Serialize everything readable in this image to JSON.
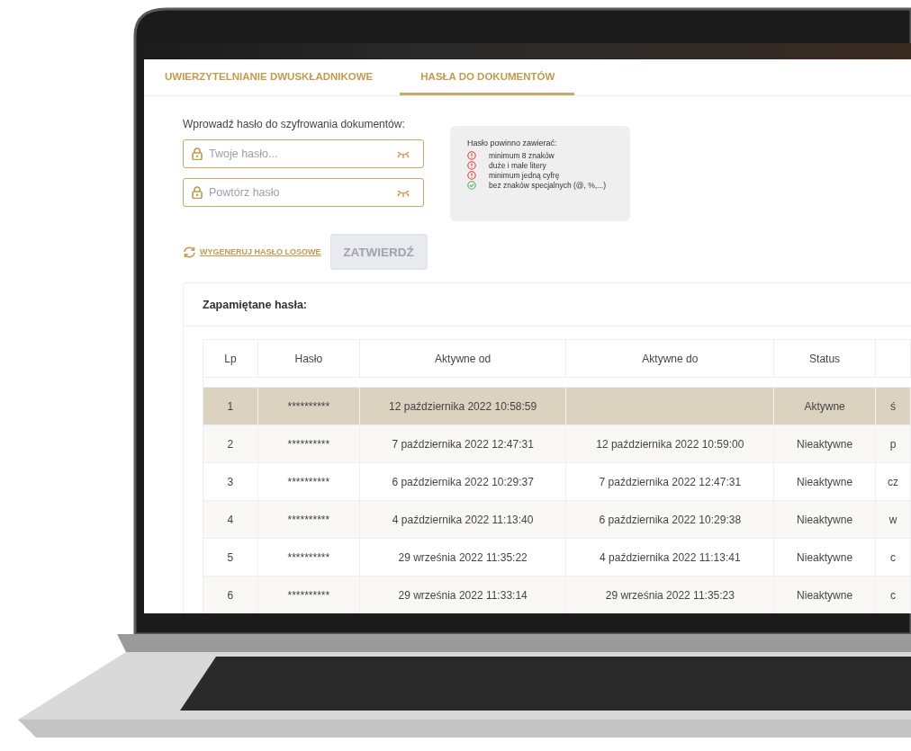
{
  "tabs": [
    {
      "label": "UWIERZYTELNIANIE DWUSKŁADNIKOWE",
      "selected": false
    },
    {
      "label": "HASŁA DO DOKUMENTÓW",
      "selected": true
    }
  ],
  "form": {
    "label": "Wprowadź hasło do szyfrowania dokumentów:",
    "fields": [
      {
        "placeholder": "Twoje hasło..."
      },
      {
        "placeholder": "Powtórz hasło"
      }
    ],
    "hint": {
      "title": "Hasło powinno zawierać:",
      "rules": [
        {
          "text": "minimum 8 znaków",
          "met": false
        },
        {
          "text": "duże i małe litery",
          "met": false
        },
        {
          "text": "minimum jedną cyfrę",
          "met": false
        },
        {
          "text": "bez znaków specjalnych (@, %,...)",
          "met": true
        }
      ]
    },
    "generate_link": "WYGENERUJ HASŁO LOSOWE",
    "submit_button": {
      "label": "ZATWIERDŹ",
      "disabled": true
    }
  },
  "saved": {
    "title": "Zapamiętane hasła:",
    "columns": [
      "Lp",
      "Hasło",
      "Aktywne od",
      "Aktywne do",
      "Status"
    ],
    "rows": [
      {
        "selected": true,
        "cells": [
          "1",
          "**********",
          "12 października 2022 10:58:59",
          "",
          "Aktywne",
          "ś"
        ]
      },
      {
        "selected": false,
        "cells": [
          "2",
          "**********",
          "7 października 2022 12:47:31",
          "12 października 2022 10:59:00",
          "Nieaktywne",
          "p"
        ]
      },
      {
        "selected": false,
        "cells": [
          "3",
          "**********",
          "6 października 2022 10:29:37",
          "7 października 2022 12:47:31",
          "Nieaktywne",
          "cz"
        ]
      },
      {
        "selected": false,
        "cells": [
          "4",
          "**********",
          "4 października 2022 11:13:40",
          "6 października 2022 10:29:38",
          "Nieaktywne",
          "w"
        ]
      },
      {
        "selected": false,
        "cells": [
          "5",
          "**********",
          "29 września 2022 11:35:22",
          "4 października 2022 11:13:41",
          "Nieaktywne",
          "c"
        ]
      },
      {
        "selected": false,
        "cells": [
          "6",
          "**********",
          "29 września 2022 11:33:14",
          "29 września 2022 11:35:23",
          "Nieaktywne",
          "c"
        ]
      }
    ]
  }
}
